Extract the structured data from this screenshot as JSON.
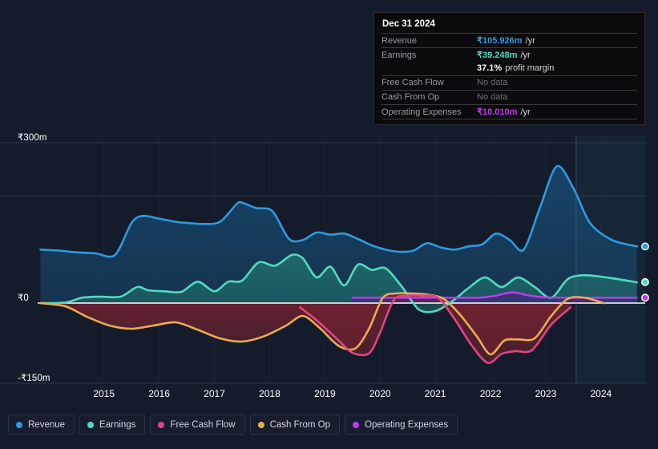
{
  "axis": {
    "y_ticks": [
      {
        "label": "₹300m",
        "value": 300
      },
      {
        "label": "₹0",
        "value": 0
      },
      {
        "label": "-₹150m",
        "value": -150
      }
    ],
    "x_ticks": [
      "2015",
      "2016",
      "2017",
      "2018",
      "2019",
      "2020",
      "2021",
      "2022",
      "2023",
      "2024"
    ]
  },
  "tooltip": {
    "title": "Dec 31 2024",
    "rows": [
      {
        "key": "Revenue",
        "amount": "₹105.926m",
        "unit": "/yr",
        "color": "#2d9ae0",
        "nodata": false
      },
      {
        "key": "Earnings",
        "amount": "₹39.248m",
        "unit": "/yr",
        "color": "#4fdbc0",
        "nodata": false
      },
      {
        "key": "",
        "amount": "37.1%",
        "unit": "profit margin",
        "color": "#ffffff",
        "nodata": false,
        "margin_row": true
      },
      {
        "key": "Free Cash Flow",
        "amount": "No data",
        "unit": "",
        "color": "#6e6e77",
        "nodata": true
      },
      {
        "key": "Cash From Op",
        "amount": "No data",
        "unit": "",
        "color": "#6e6e77",
        "nodata": true
      },
      {
        "key": "Operating Expenses",
        "amount": "₹10.010m",
        "unit": "/yr",
        "color": "#c03cf0",
        "nodata": false
      }
    ]
  },
  "legend": {
    "items": [
      {
        "label": "Revenue",
        "color": "#2d9ae0"
      },
      {
        "label": "Earnings",
        "color": "#4fdbc0"
      },
      {
        "label": "Free Cash Flow",
        "color": "#e0457f"
      },
      {
        "label": "Cash From Op",
        "color": "#e8ad4e"
      },
      {
        "label": "Operating Expenses",
        "color": "#c03cf0"
      }
    ]
  },
  "chart_data": {
    "type": "area",
    "title": "",
    "xlabel": "",
    "ylabel": "",
    "ylim": [
      -150,
      300
    ],
    "xlim": [
      2014.3,
      2025.3
    ],
    "grid": true,
    "currency": "INR",
    "units": "millions",
    "gridlines": [
      300,
      200,
      0,
      -150
    ],
    "zero_line": 0,
    "forecast_start": 2024.05,
    "series": [
      {
        "name": "Revenue",
        "color": "#2d9ae0",
        "fill": "#17466b",
        "x": [
          2014.35,
          2014.7,
          2015.0,
          2015.35,
          2015.7,
          2016.0,
          2016.2,
          2016.5,
          2016.8,
          2017.0,
          2017.3,
          2017.6,
          2017.9,
          2018.0,
          2018.25,
          2018.55,
          2018.85,
          2019.1,
          2019.35,
          2019.6,
          2019.85,
          2020.1,
          2020.35,
          2020.6,
          2020.85,
          2021.1,
          2021.35,
          2021.6,
          2021.85,
          2022.1,
          2022.35,
          2022.6,
          2022.85,
          2023.1,
          2023.4,
          2023.7,
          2024.0,
          2024.3,
          2024.7,
          2025.15
        ],
        "y": [
          100,
          98,
          95,
          93,
          90,
          150,
          163,
          158,
          152,
          150,
          148,
          152,
          185,
          188,
          178,
          172,
          120,
          118,
          132,
          128,
          130,
          120,
          108,
          100,
          96,
          98,
          112,
          104,
          100,
          106,
          110,
          130,
          118,
          100,
          180,
          256,
          215,
          150,
          118,
          106
        ]
      },
      {
        "name": "Earnings",
        "color": "#4fdbc0",
        "fill": "#1f6b6b",
        "x": [
          2014.35,
          2014.8,
          2015.1,
          2015.4,
          2015.8,
          2016.1,
          2016.3,
          2016.6,
          2016.9,
          2017.2,
          2017.5,
          2017.75,
          2018.0,
          2018.3,
          2018.6,
          2018.9,
          2019.1,
          2019.35,
          2019.6,
          2019.85,
          2020.1,
          2020.35,
          2020.6,
          2020.9,
          2021.2,
          2021.5,
          2021.8,
          2022.1,
          2022.4,
          2022.7,
          2023.0,
          2023.3,
          2023.6,
          2023.9,
          2024.2,
          2024.6,
          2025.15
        ],
        "y": [
          0,
          1,
          10,
          12,
          12,
          30,
          24,
          22,
          21,
          40,
          22,
          40,
          42,
          76,
          70,
          90,
          84,
          48,
          68,
          33,
          72,
          62,
          65,
          30,
          -12,
          -15,
          3,
          28,
          48,
          30,
          48,
          30,
          10,
          45,
          52,
          48,
          39
        ]
      },
      {
        "name": "Free Cash Flow",
        "color": "#e0457f",
        "fill": "#6d2130",
        "x": [
          2019.05,
          2019.35,
          2019.7,
          2020.0,
          2020.3,
          2020.5,
          2020.75,
          2021.0,
          2021.25,
          2021.55,
          2021.85,
          2022.15,
          2022.45,
          2022.7,
          2022.95,
          2023.25,
          2023.6,
          2023.95
        ],
        "y": [
          -8,
          -32,
          -65,
          -93,
          -94,
          -55,
          6,
          14,
          14,
          10,
          -30,
          -78,
          -112,
          -95,
          -90,
          -88,
          -40,
          -8
        ]
      },
      {
        "name": "Cash From Op",
        "color": "#e8ad4e",
        "fill": "#6d2130",
        "x": [
          2014.35,
          2014.8,
          2015.2,
          2015.6,
          2016.0,
          2016.4,
          2016.8,
          2017.2,
          2017.6,
          2018.0,
          2018.4,
          2018.8,
          2019.1,
          2019.4,
          2019.75,
          2020.05,
          2020.3,
          2020.55,
          2020.8,
          2021.05,
          2021.35,
          2021.65,
          2021.95,
          2022.25,
          2022.5,
          2022.75,
          2023.0,
          2023.3,
          2023.6,
          2023.9,
          2024.2,
          2024.55
        ],
        "y": [
          0,
          -6,
          -26,
          -42,
          -48,
          -42,
          -36,
          -50,
          -66,
          -72,
          -62,
          -42,
          -24,
          -46,
          -80,
          -85,
          -48,
          10,
          18,
          18,
          16,
          8,
          -22,
          -62,
          -96,
          -70,
          -68,
          -66,
          -24,
          8,
          10,
          0
        ]
      },
      {
        "name": "Operating Expenses",
        "color": "#c03cf0",
        "fill": "#3f2a7a",
        "x": [
          2020.0,
          2020.4,
          2020.8,
          2021.1,
          2021.4,
          2021.7,
          2022.0,
          2022.3,
          2022.6,
          2022.9,
          2023.2,
          2023.5,
          2023.9,
          2024.3,
          2024.8,
          2025.15
        ],
        "y": [
          10,
          10,
          10,
          10,
          10,
          10,
          10,
          10,
          14,
          20,
          14,
          11,
          10,
          10,
          10,
          10
        ]
      }
    ],
    "endpoints": [
      {
        "name": "Revenue",
        "value": 105.926,
        "color": "#2d9ae0"
      },
      {
        "name": "Earnings",
        "value": 39.248,
        "color": "#4fdbc0"
      },
      {
        "name": "Operating Expenses",
        "value": 10.01,
        "color": "#c03cf0"
      }
    ]
  }
}
